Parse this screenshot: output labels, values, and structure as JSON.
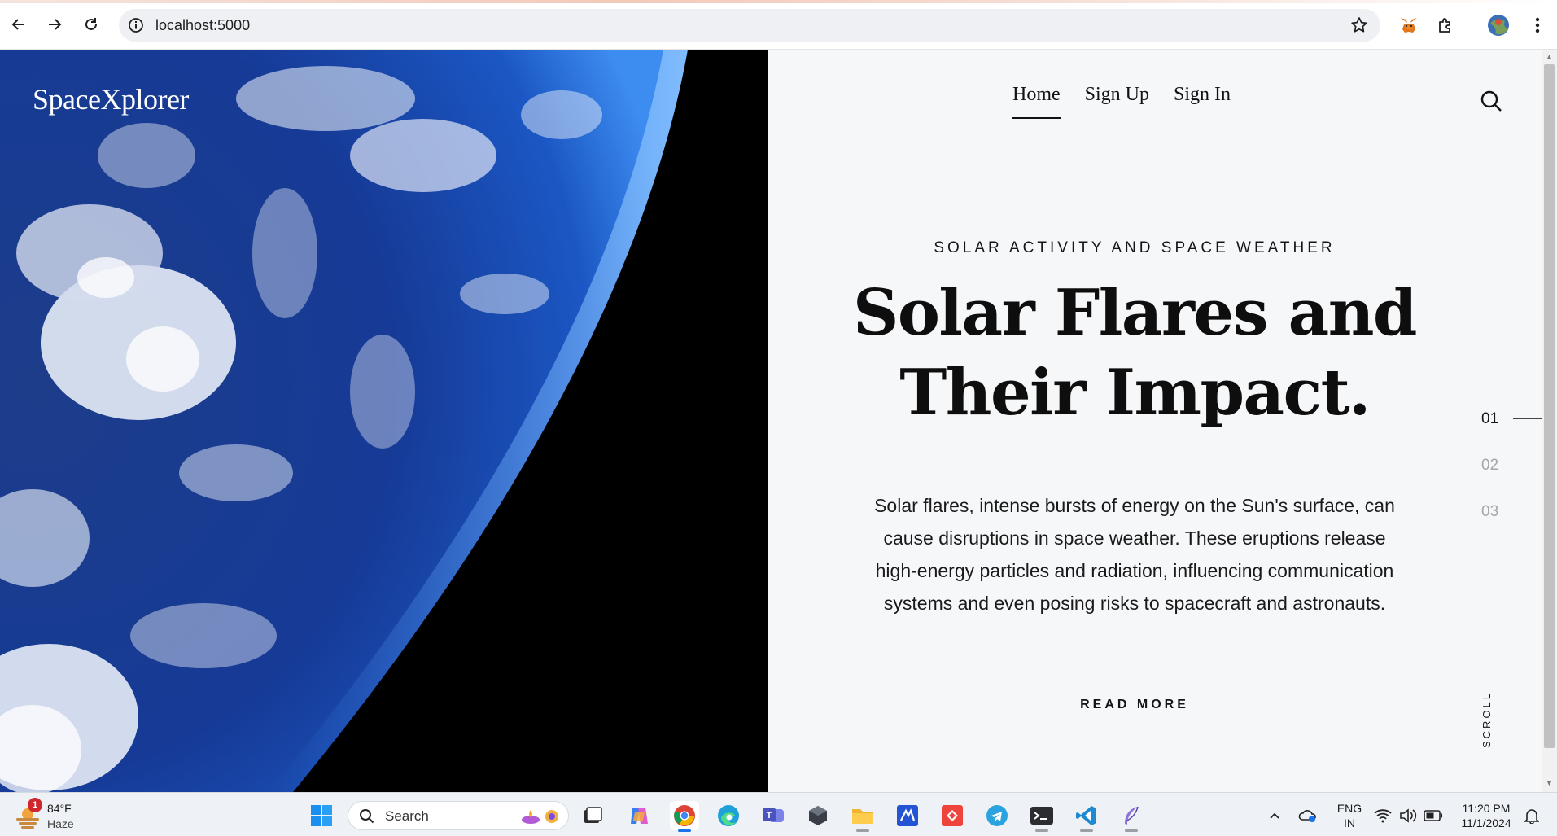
{
  "browser": {
    "url": "localhost:5000",
    "icons": [
      "back-icon",
      "forward-icon",
      "reload-icon",
      "site-info-icon",
      "bookmark-star-icon",
      "metamask-extension-icon",
      "extensions-icon",
      "profile-avatar",
      "menu-kebab-icon"
    ]
  },
  "site": {
    "logo": "SpaceXplorer",
    "nav": [
      {
        "label": "Home",
        "active": true
      },
      {
        "label": "Sign Up",
        "active": false
      },
      {
        "label": "Sign In",
        "active": false
      }
    ]
  },
  "hero": {
    "kicker": "SOLAR ACTIVITY AND SPACE WEATHER",
    "headline_line1": "Solar Flares and",
    "headline_line2": "Their Impact.",
    "body": "Solar flares, intense bursts of energy on the Sun's surface, can cause disruptions in space weather. These eruptions release high-energy particles and radiation, influencing communication systems and even posing risks to spacecraft and astronauts.",
    "read_more": "READ MORE"
  },
  "pager": {
    "items": [
      "01",
      "02",
      "03"
    ],
    "active_index": 0,
    "scroll_label": "SCROLL"
  },
  "taskbar": {
    "weather": {
      "temp": "84°F",
      "condition": "Haze",
      "badge": "1"
    },
    "search_placeholder": "Search",
    "apps": [
      "windows-start-icon",
      "task-view-icon",
      "copilot-icon",
      "chrome-icon",
      "edge-icon",
      "teams-icon",
      "cube-app-icon",
      "file-explorer-icon",
      "visual-studio-icon",
      "anydesk-icon",
      "telegram-icon",
      "terminal-icon",
      "vscode-icon",
      "feather-app-icon"
    ],
    "active_app": "chrome-icon",
    "lang_line1": "ENG",
    "lang_line2": "IN",
    "time": "11:20 PM",
    "date": "11/1/2024"
  },
  "colors": {
    "page_bg": "#f6f7f9",
    "text": "#121212",
    "muted_pager": "#a3a6ab",
    "taskbar_bg": "#eef1f6"
  }
}
